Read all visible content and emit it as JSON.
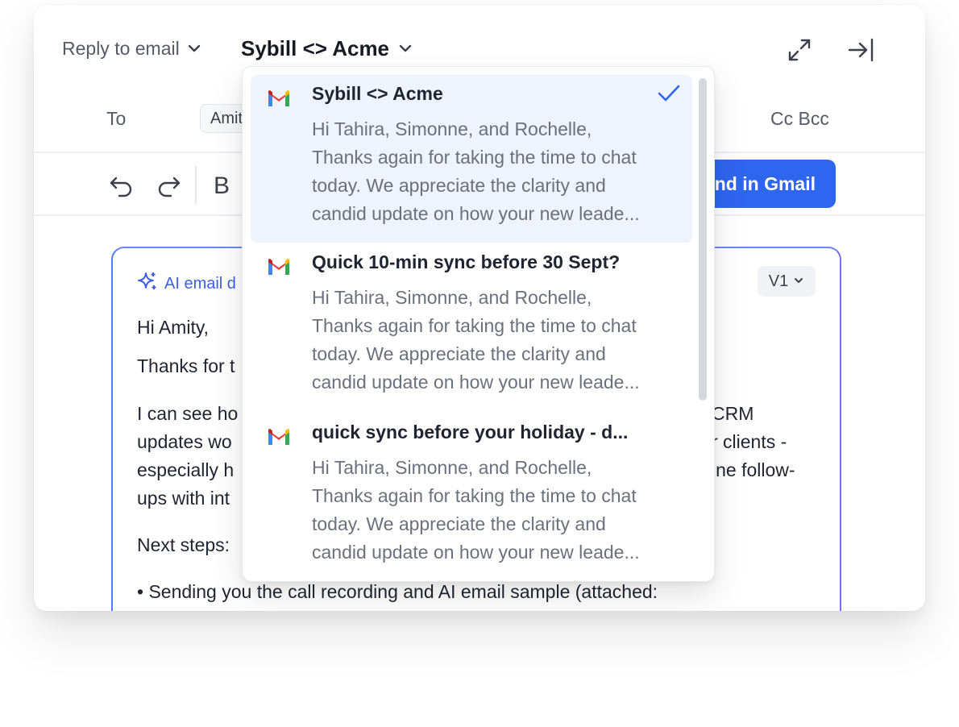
{
  "header": {
    "reply_mode": "Reply to email",
    "thread_subject": "Sybill <> Acme"
  },
  "recipients": {
    "to_label": "To",
    "to_chip": "Amit",
    "cc_bcc": "Cc Bcc"
  },
  "toolbar": {
    "bold_label": "B",
    "send_label": "Send in Gmail"
  },
  "draft": {
    "badge": "AI email d",
    "version": "V1",
    "greeting": "Hi Amity,",
    "line_thanks": "Thanks for t",
    "para_left": [
      "I can see ho",
      "updates wo",
      "especially h",
      "ups with int"
    ],
    "para_right": [
      "CRM",
      "r clients -",
      "ine follow-"
    ],
    "next_steps": "Next steps:",
    "bullet1": "• Sending you the call recording and AI email sample (attached:"
  },
  "dropdown": {
    "items": [
      {
        "subject": "Sybill <> Acme",
        "preview": [
          "Hi Tahira, Simonne, and Rochelle,",
          "Thanks again for taking the time to chat",
          "today. We appreciate the clarity and",
          "candid update on how your new leade..."
        ],
        "selected": true
      },
      {
        "subject": "Quick 10-min sync before 30 Sept?",
        "preview": [
          "Hi Tahira, Simonne, and Rochelle,",
          "Thanks again for taking the time to chat",
          "today. We appreciate the clarity and",
          "candid update on how your new leade..."
        ],
        "selected": false
      },
      {
        "subject": "quick sync before your holiday - d...",
        "preview": [
          "Hi Tahira, Simonne, and Rochelle,",
          "Thanks again for taking the time to chat",
          "today. We appreciate the clarity and",
          "candid update on how your new leade..."
        ],
        "selected": false
      }
    ]
  },
  "colors": {
    "accent": "#2f66f0",
    "selected_bg": "#eef3fd",
    "ai_badge": "#3e5fe6"
  },
  "icons": [
    "chevron-down-icon",
    "expand-icon",
    "collapse-panel-icon",
    "undo-icon",
    "redo-icon",
    "sparkle-icon",
    "gmail-icon",
    "check-icon"
  ]
}
